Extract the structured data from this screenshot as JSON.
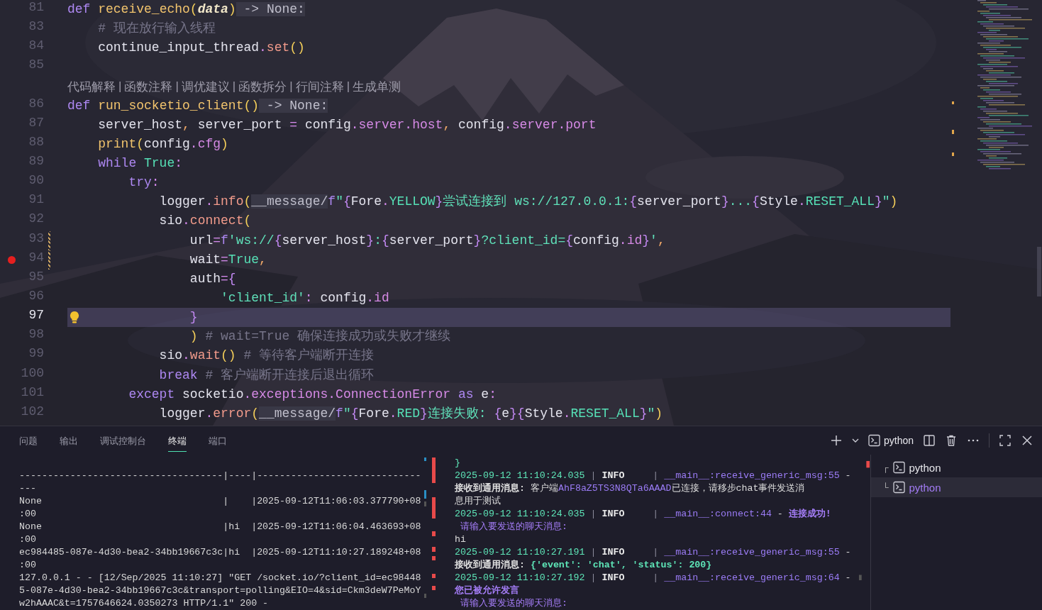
{
  "editor": {
    "lines": [
      {
        "kind": "code",
        "number": "81",
        "current": false,
        "breakpoint": false,
        "modified": false,
        "lightbulb": false,
        "segments": [
          {
            "text": "def ",
            "kind": "kw"
          },
          {
            "text": "receive_echo",
            "kind": "fn"
          },
          {
            "text": "(",
            "kind": "paren"
          },
          {
            "text": "data",
            "kind": "param"
          },
          {
            "text": ")",
            "kind": "paren"
          },
          {
            "text": " -> None:",
            "kind": "hint"
          }
        ]
      },
      {
        "kind": "code",
        "number": "83",
        "current": false,
        "breakpoint": false,
        "modified": false,
        "lightbulb": false,
        "segments": [
          {
            "text": "    # 现在放行输入线程",
            "kind": "comment"
          }
        ]
      },
      {
        "kind": "code",
        "number": "84",
        "current": false,
        "breakpoint": false,
        "modified": false,
        "lightbulb": false,
        "segments": [
          {
            "text": "    continue_input_thread",
            "kind": "id"
          },
          {
            "text": ".",
            "kind": "op"
          },
          {
            "text": "set",
            "kind": "meth"
          },
          {
            "text": "()",
            "kind": "paren"
          }
        ]
      },
      {
        "kind": "code",
        "number": "85",
        "current": false,
        "breakpoint": false,
        "modified": false,
        "lightbulb": false
      },
      {
        "kind": "codelens",
        "separator": "|",
        "actions": [
          "代码解释",
          "函数注释",
          "调优建议",
          "函数拆分",
          "行间注释",
          "生成单测"
        ]
      },
      {
        "kind": "code",
        "number": "86",
        "current": false,
        "breakpoint": false,
        "modified": false,
        "lightbulb": false,
        "segments": [
          {
            "text": "def ",
            "kind": "kw"
          },
          {
            "text": "run_socketio_client",
            "kind": "fn"
          },
          {
            "text": "()",
            "kind": "paren"
          },
          {
            "text": " -> None:",
            "kind": "hint"
          }
        ]
      },
      {
        "kind": "code",
        "number": "87",
        "current": false,
        "breakpoint": false,
        "modified": false,
        "lightbulb": false,
        "segments": [
          {
            "text": "    server_host",
            "kind": "id"
          },
          {
            "text": ",",
            "kind": "punct"
          },
          {
            "text": " server_port ",
            "kind": "id"
          },
          {
            "text": "=",
            "kind": "op"
          },
          {
            "text": " config",
            "kind": "id"
          },
          {
            "text": ".",
            "kind": "op"
          },
          {
            "text": "server",
            "kind": "prop"
          },
          {
            "text": ".",
            "kind": "op"
          },
          {
            "text": "host",
            "kind": "prop"
          },
          {
            "text": ",",
            "kind": "punct"
          },
          {
            "text": " config",
            "kind": "id"
          },
          {
            "text": ".",
            "kind": "op"
          },
          {
            "text": "server",
            "kind": "prop"
          },
          {
            "text": ".",
            "kind": "op"
          },
          {
            "text": "port",
            "kind": "prop"
          }
        ]
      },
      {
        "kind": "code",
        "number": "88",
        "current": false,
        "breakpoint": false,
        "modified": false,
        "lightbulb": false,
        "segments": [
          {
            "text": "    print",
            "kind": "fn"
          },
          {
            "text": "(",
            "kind": "paren"
          },
          {
            "text": "config",
            "kind": "id"
          },
          {
            "text": ".",
            "kind": "op"
          },
          {
            "text": "cfg",
            "kind": "prop"
          },
          {
            "text": ")",
            "kind": "paren"
          }
        ]
      },
      {
        "kind": "code",
        "number": "89",
        "current": false,
        "breakpoint": false,
        "modified": false,
        "lightbulb": false,
        "segments": [
          {
            "text": "    while",
            "kind": "kw"
          },
          {
            "text": " True",
            "kind": "const"
          },
          {
            "text": ":",
            "kind": "op"
          }
        ]
      },
      {
        "kind": "code",
        "number": "90",
        "current": false,
        "breakpoint": false,
        "modified": false,
        "lightbulb": false,
        "segments": [
          {
            "text": "        try",
            "kind": "kw"
          },
          {
            "text": ":",
            "kind": "op"
          }
        ]
      },
      {
        "kind": "code",
        "number": "91",
        "current": false,
        "breakpoint": false,
        "modified": false,
        "lightbulb": false,
        "segments": [
          {
            "text": "            logger",
            "kind": "id"
          },
          {
            "text": ".",
            "kind": "op"
          },
          {
            "text": "info",
            "kind": "meth"
          },
          {
            "text": "(",
            "kind": "paren"
          },
          {
            "text": "__message/",
            "kind": "hint"
          },
          {
            "text": "f",
            "kind": "kw"
          },
          {
            "text": "\"",
            "kind": "str"
          },
          {
            "text": "{",
            "kind": "brace"
          },
          {
            "text": "Fore",
            "kind": "id"
          },
          {
            "text": ".",
            "kind": "op"
          },
          {
            "text": "YELLOW",
            "kind": "const"
          },
          {
            "text": "}",
            "kind": "brace"
          },
          {
            "text": "尝试连接到 ws://127.0.0.1:",
            "kind": "str"
          },
          {
            "text": "{",
            "kind": "brace"
          },
          {
            "text": "server_port",
            "kind": "id"
          },
          {
            "text": "}",
            "kind": "brace"
          },
          {
            "text": "...",
            "kind": "str"
          },
          {
            "text": "{",
            "kind": "brace"
          },
          {
            "text": "Style",
            "kind": "id"
          },
          {
            "text": ".",
            "kind": "op"
          },
          {
            "text": "RESET_ALL",
            "kind": "const"
          },
          {
            "text": "}",
            "kind": "brace"
          },
          {
            "text": "\"",
            "kind": "str"
          },
          {
            "text": ")",
            "kind": "paren"
          }
        ]
      },
      {
        "kind": "code",
        "number": "92",
        "current": false,
        "breakpoint": false,
        "modified": false,
        "lightbulb": false,
        "segments": [
          {
            "text": "            sio",
            "kind": "id"
          },
          {
            "text": ".",
            "kind": "op"
          },
          {
            "text": "connect",
            "kind": "meth"
          },
          {
            "text": "(",
            "kind": "paren"
          }
        ]
      },
      {
        "kind": "code",
        "number": "93",
        "current": false,
        "breakpoint": false,
        "modified": true,
        "lightbulb": false,
        "segments": [
          {
            "text": "                url",
            "kind": "id"
          },
          {
            "text": "=",
            "kind": "op"
          },
          {
            "text": "f",
            "kind": "kw"
          },
          {
            "text": "'ws://",
            "kind": "str"
          },
          {
            "text": "{",
            "kind": "brace"
          },
          {
            "text": "server_host",
            "kind": "id"
          },
          {
            "text": "}",
            "kind": "brace"
          },
          {
            "text": ":",
            "kind": "str"
          },
          {
            "text": "{",
            "kind": "brace"
          },
          {
            "text": "server_port",
            "kind": "id"
          },
          {
            "text": "}",
            "kind": "brace"
          },
          {
            "text": "?client_id=",
            "kind": "str"
          },
          {
            "text": "{",
            "kind": "brace"
          },
          {
            "text": "config",
            "kind": "id"
          },
          {
            "text": ".",
            "kind": "op"
          },
          {
            "text": "id",
            "kind": "prop"
          },
          {
            "text": "}",
            "kind": "brace"
          },
          {
            "text": "'",
            "kind": "str"
          },
          {
            "text": ",",
            "kind": "punct"
          }
        ]
      },
      {
        "kind": "code",
        "number": "94",
        "current": false,
        "breakpoint": true,
        "modified": true,
        "lightbulb": false,
        "segments": [
          {
            "text": "                wait",
            "kind": "id"
          },
          {
            "text": "=",
            "kind": "op"
          },
          {
            "text": "True",
            "kind": "const"
          },
          {
            "text": ",",
            "kind": "punct"
          }
        ]
      },
      {
        "kind": "code",
        "number": "95",
        "current": false,
        "breakpoint": false,
        "modified": false,
        "lightbulb": false,
        "segments": [
          {
            "text": "                auth",
            "kind": "id"
          },
          {
            "text": "=",
            "kind": "op"
          },
          {
            "text": "{",
            "kind": "brace"
          }
        ]
      },
      {
        "kind": "code",
        "number": "96",
        "current": false,
        "breakpoint": false,
        "modified": false,
        "lightbulb": false,
        "segments": [
          {
            "text": "                    'client_id'",
            "kind": "str"
          },
          {
            "text": ":",
            "kind": "op"
          },
          {
            "text": " config",
            "kind": "id"
          },
          {
            "text": ".",
            "kind": "op"
          },
          {
            "text": "id",
            "kind": "prop"
          }
        ]
      },
      {
        "kind": "code",
        "number": "97",
        "current": true,
        "breakpoint": false,
        "modified": false,
        "lightbulb": true,
        "segments": [
          {
            "text": "                }",
            "kind": "brace"
          }
        ]
      },
      {
        "kind": "code",
        "number": "98",
        "current": false,
        "breakpoint": false,
        "modified": false,
        "lightbulb": false,
        "segments": [
          {
            "text": "                )",
            "kind": "paren"
          },
          {
            "text": " # wait=True 确保连接成功或失败才继续",
            "kind": "comment"
          }
        ]
      },
      {
        "kind": "code",
        "number": "99",
        "current": false,
        "breakpoint": false,
        "modified": false,
        "lightbulb": false,
        "segments": [
          {
            "text": "            sio",
            "kind": "id"
          },
          {
            "text": ".",
            "kind": "op"
          },
          {
            "text": "wait",
            "kind": "meth"
          },
          {
            "text": "()",
            "kind": "paren"
          },
          {
            "text": " # 等待客户端断开连接",
            "kind": "comment"
          }
        ]
      },
      {
        "kind": "code",
        "number": "100",
        "current": false,
        "breakpoint": false,
        "modified": false,
        "lightbulb": false,
        "segments": [
          {
            "text": "            break",
            "kind": "kw"
          },
          {
            "text": " # 客户端断开连接后退出循环",
            "kind": "comment"
          }
        ]
      },
      {
        "kind": "code",
        "number": "101",
        "current": false,
        "breakpoint": false,
        "modified": false,
        "lightbulb": false,
        "segments": [
          {
            "text": "        except",
            "kind": "kw"
          },
          {
            "text": " socketio",
            "kind": "id"
          },
          {
            "text": ".",
            "kind": "op"
          },
          {
            "text": "exceptions",
            "kind": "prop"
          },
          {
            "text": ".",
            "kind": "op"
          },
          {
            "text": "ConnectionError",
            "kind": "prop"
          },
          {
            "text": " as",
            "kind": "kw"
          },
          {
            "text": " e",
            "kind": "id"
          },
          {
            "text": ":",
            "kind": "op"
          }
        ]
      },
      {
        "kind": "code",
        "number": "102",
        "current": false,
        "breakpoint": false,
        "modified": false,
        "lightbulb": false,
        "segments": [
          {
            "text": "            logger",
            "kind": "id"
          },
          {
            "text": ".",
            "kind": "op"
          },
          {
            "text": "error",
            "kind": "meth"
          },
          {
            "text": "(",
            "kind": "paren"
          },
          {
            "text": "__message/",
            "kind": "hint"
          },
          {
            "text": "f",
            "kind": "kw"
          },
          {
            "text": "\"",
            "kind": "str"
          },
          {
            "text": "{",
            "kind": "brace"
          },
          {
            "text": "Fore",
            "kind": "id"
          },
          {
            "text": ".",
            "kind": "op"
          },
          {
            "text": "RED",
            "kind": "const"
          },
          {
            "text": "}",
            "kind": "brace"
          },
          {
            "text": "连接失败: ",
            "kind": "str"
          },
          {
            "text": "{",
            "kind": "brace"
          },
          {
            "text": "e",
            "kind": "id"
          },
          {
            "text": "}",
            "kind": "brace"
          },
          {
            "text": "{",
            "kind": "brace"
          },
          {
            "text": "Style",
            "kind": "id"
          },
          {
            "text": ".",
            "kind": "op"
          },
          {
            "text": "RESET_ALL",
            "kind": "const"
          },
          {
            "text": "}",
            "kind": "brace"
          },
          {
            "text": "\"",
            "kind": "str"
          },
          {
            "text": ")",
            "kind": "paren"
          }
        ]
      }
    ]
  },
  "terminal": {
    "tabs": [
      {
        "label": "问题",
        "selected": false
      },
      {
        "label": "输出",
        "selected": false
      },
      {
        "label": "调试控制台",
        "selected": false
      },
      {
        "label": "终端",
        "selected": true
      },
      {
        "label": "端口",
        "selected": false
      }
    ],
    "profile": "python",
    "left_pane": [
      "------------------------------------|----|-----------------------------",
      "---",
      "None                                |    |2025-09-12T11:06:03.377790+08",
      ":00",
      "None                                |hi  |2025-09-12T11:06:04.463693+08",
      ":00",
      "ec984485-087e-4d30-bea2-34bb19667c3c|hi  |2025-09-12T11:10:27.189248+08",
      ":00",
      "127.0.0.1 - - [12/Sep/2025 11:10:27] \"GET /socket.io/?client_id=ec98448",
      "5-087e-4d30-bea2-34bb19667c3c&transport=polling&EIO=4&sid=Ckm3deW7PeMoY",
      "w2hAAAC&t=1757646624.0350273 HTTP/1.1\" 200 -"
    ],
    "right_pane": [
      [
        {
          "text": "}",
          "kind": "ts"
        }
      ],
      [
        {
          "text": "2025-09-12 11:10:24.035",
          "kind": "ts"
        },
        {
          "text": " | ",
          "kind": "sep"
        },
        {
          "text": "INFO",
          "kind": "lvl"
        },
        {
          "text": "     | ",
          "kind": "sep"
        },
        {
          "text": "__main__:receive_generic_msg:55",
          "kind": "mod"
        },
        {
          "text": " -",
          "kind": "txt"
        }
      ],
      [
        {
          "text": "接收到通用消息:",
          "kind": "bold"
        },
        {
          "text": " 客户端",
          "kind": "txt"
        },
        {
          "text": "AhF8aZ5TS3N8QTa6AAAD",
          "kind": "mod"
        },
        {
          "text": "已连接，请移步chat事件发送消",
          "kind": "txt"
        }
      ],
      [
        {
          "text": "息用于测试",
          "kind": "txt"
        }
      ],
      [
        {
          "text": "2025-09-12 11:10:24.035",
          "kind": "ts"
        },
        {
          "text": " | ",
          "kind": "sep"
        },
        {
          "text": "INFO",
          "kind": "lvl"
        },
        {
          "text": "     | ",
          "kind": "sep"
        },
        {
          "text": "__main__:connect:44",
          "kind": "mod"
        },
        {
          "text": " - ",
          "kind": "txt"
        },
        {
          "text": "连接成功!",
          "kind": "accb"
        }
      ],
      [
        {
          "text": " 请输入要发送的聊天消息:",
          "kind": "acc"
        }
      ],
      [
        {
          "text": "hi",
          "kind": "txt"
        }
      ],
      [
        {
          "text": "2025-09-12 11:10:27.191",
          "kind": "ts"
        },
        {
          "text": " | ",
          "kind": "sep"
        },
        {
          "text": "INFO",
          "kind": "lvl"
        },
        {
          "text": "     | ",
          "kind": "sep"
        },
        {
          "text": "__main__:receive_generic_msg:55",
          "kind": "mod"
        },
        {
          "text": " -",
          "kind": "txt"
        }
      ],
      [
        {
          "text": "接收到通用消息:",
          "kind": "bold"
        },
        {
          "text": " {'event': 'chat', 'status': 200}",
          "kind": "dict"
        }
      ],
      [
        {
          "text": "2025-09-12 11:10:27.192",
          "kind": "ts"
        },
        {
          "text": " | ",
          "kind": "sep"
        },
        {
          "text": "INFO",
          "kind": "lvl"
        },
        {
          "text": "     | ",
          "kind": "sep"
        },
        {
          "text": "__main__:receive_generic_msg:64",
          "kind": "mod"
        },
        {
          "text": " -",
          "kind": "txt"
        }
      ],
      [
        {
          "text": "您已被允许发言",
          "kind": "accb"
        }
      ],
      [
        {
          "text": " 请输入要发送的聊天消息:",
          "kind": "acc"
        }
      ]
    ],
    "sessions": [
      {
        "branch": "┌",
        "label": "python",
        "selected": false
      },
      {
        "branch": "└",
        "label": "python",
        "selected": true
      }
    ]
  }
}
